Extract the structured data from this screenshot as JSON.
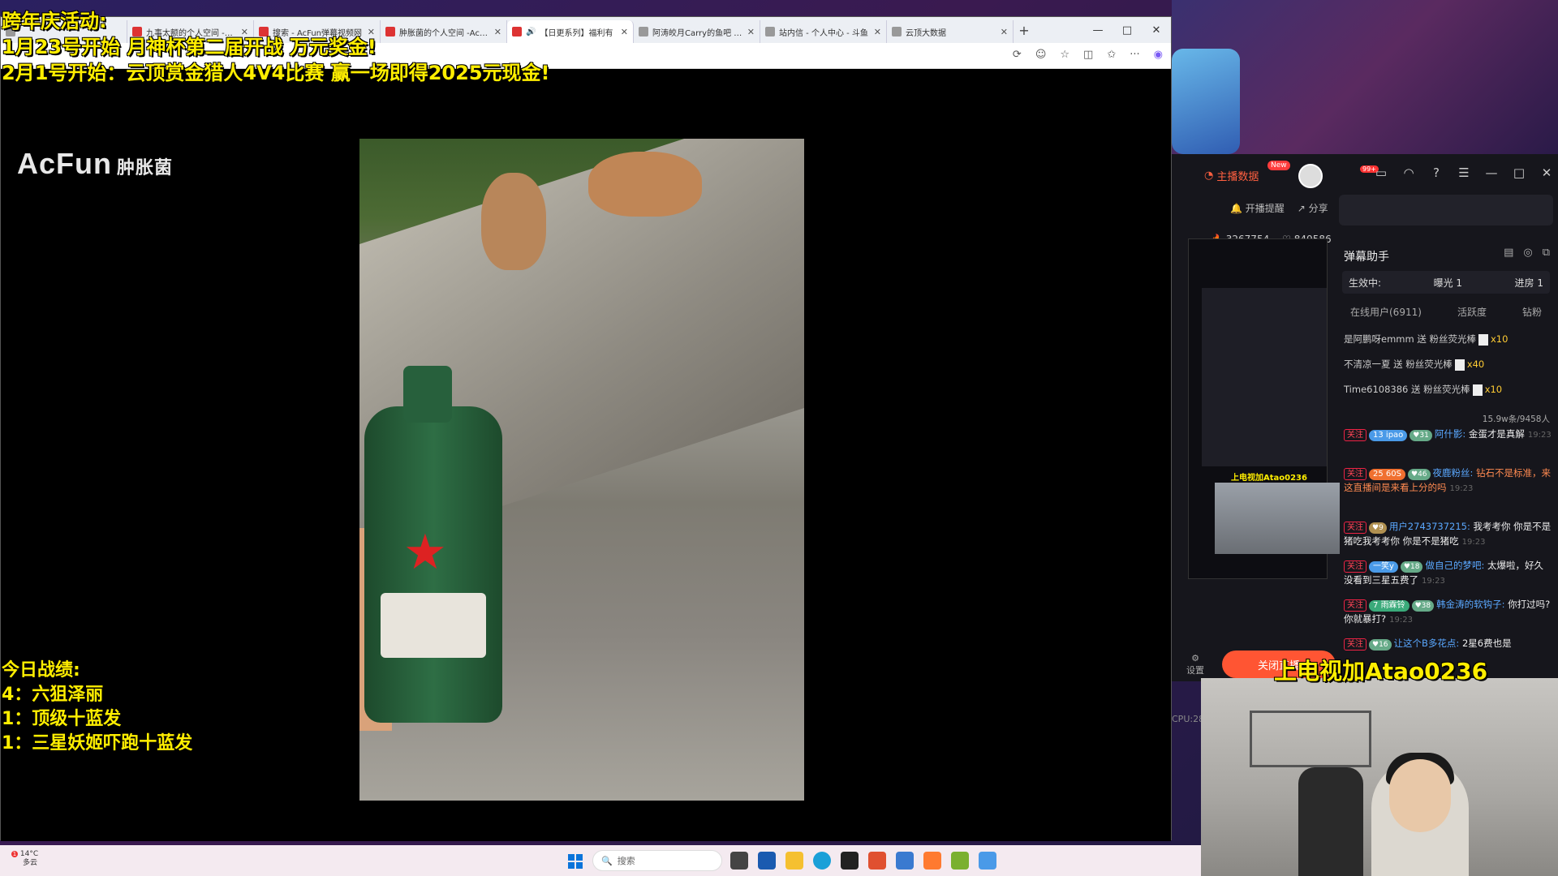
{
  "browser": {
    "tabs": [
      {
        "label": "",
        "active": false
      },
      {
        "label": "九事太额的个人空间 -AcF",
        "active": false
      },
      {
        "label": "搜索 - AcFun弹幕视频网",
        "active": false
      },
      {
        "label": "肿胀菌的个人空间 -AcFun",
        "active": false
      },
      {
        "label": "【日更系列】福利有",
        "active": true
      },
      {
        "label": "阿涛皎月Carry的鱼吧 -斗鱼",
        "active": false
      },
      {
        "label": "站内信 - 个人中心 - 斗鱼",
        "active": false
      },
      {
        "label": "云顶大数据",
        "active": false
      }
    ],
    "new_tab": "+",
    "win_controls": [
      "—",
      "□",
      "✕"
    ]
  },
  "video_page": {
    "logo": "AcFun",
    "uploader": "肿胀菌"
  },
  "overlay": {
    "line1": "跨年庆活动:",
    "line2": "1月23号开始 月神杯第二届开战 万元奖金!",
    "line3": "2月1号开始：云顶赏金猎人4V4比赛 赢一场即得2025元现金!",
    "record_title": "今日战绩:",
    "records": [
      "4：六狙泽丽",
      "1：顶级十蓝发",
      "1：三星妖姬吓跑十蓝发"
    ]
  },
  "streamer_panel": {
    "host_data": "主播数据",
    "new_badge": "New",
    "msg_badge": "99+",
    "remind": "开播提醒",
    "share": "分享",
    "hot": "3267754",
    "likes": "849586",
    "danmu_title": "弹幕助手",
    "status": {
      "active": "生效中:",
      "exposure": "曝光 1",
      "enter": "进房 1"
    },
    "sub_tabs": [
      "在线用户(6911)",
      "活跃度",
      "钻粉"
    ],
    "gifts": [
      {
        "user": "是阿鹏呀emmm",
        "action": "送 粉丝荧光棒",
        "count": "x10"
      },
      {
        "user": "不清凉一夏",
        "action": "送 粉丝荧光棒",
        "count": "x40"
      },
      {
        "user": "Time6108386",
        "action": "送 粉丝荧光棒",
        "count": "x10"
      }
    ],
    "rate": "15.9w条/9458人",
    "follow_tag": "关注",
    "chats": [
      {
        "lv": "13",
        "badge": "ipao",
        "fan": "31",
        "user": "阿什影:",
        "text": "金蛋才是真解",
        "time": "19:23"
      },
      {
        "lv": "25",
        "badge": "60S",
        "fan": "46",
        "user": "夜鹿粉丝:",
        "text": "钻石不是标准，来这直播间是来看上分的吗",
        "time": "19:23"
      },
      {
        "lv": "",
        "badge": "",
        "fan": "9",
        "user": "用户2743737215:",
        "text": "我考考你 你是不是猪吃我考考你 你是不是猪吃",
        "time": "19:23"
      },
      {
        "lv": "",
        "badge": "一笑y",
        "fan": "18",
        "user": "做自己的梦吧:",
        "text": "太爆啦，好久没看到三星五费了",
        "time": "19:23"
      },
      {
        "lv": "7",
        "badge": "雨霖铃",
        "fan": "38",
        "user": "韩金涛的软钩子:",
        "text": "你打过吗? 你就暴打?",
        "time": "19:23"
      },
      {
        "lv": "",
        "badge": "",
        "fan": "16",
        "user": "让这个B多花点:",
        "text": "2星6费也是",
        "time": ""
      }
    ],
    "preview_tag": "上电视加Atao0236",
    "settings": "设置",
    "close_live": "关闭直播",
    "cpu": "CPU:28%"
  },
  "webcam": {
    "title": "上电视加Atao0236"
  },
  "taskbar": {
    "temp": "14°C",
    "weather": "多云",
    "search": "搜索",
    "notice": "1"
  }
}
